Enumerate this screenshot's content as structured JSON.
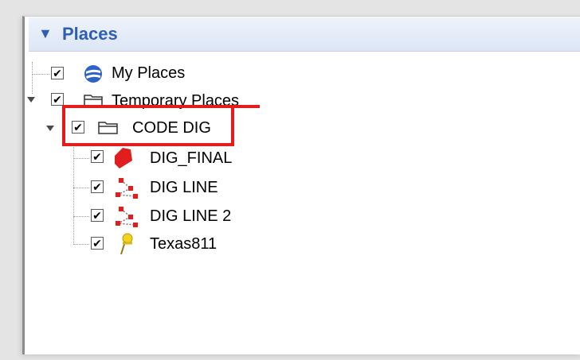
{
  "header": {
    "title": "Places",
    "icon": "triangle-down-icon"
  },
  "tree": {
    "my_places": {
      "label": "My Places",
      "checked": "✔",
      "icon": "earth-icon"
    },
    "temporary_places": {
      "label": "Temporary Places",
      "checked": "✔",
      "icon": "folder-icon"
    },
    "code_dig": {
      "label": "CODE DIG",
      "checked": "✔",
      "icon": "folder-icon"
    },
    "children": [
      {
        "label": "DIG_FINAL",
        "checked": "✔",
        "icon": "polygon-icon"
      },
      {
        "label": "DIG LINE",
        "checked": "✔",
        "icon": "path-icon"
      },
      {
        "label": "DIG LINE 2",
        "checked": "✔",
        "icon": "path-icon"
      },
      {
        "label": "Texas811",
        "checked": "✔",
        "icon": "pushpin-icon"
      }
    ]
  },
  "colors": {
    "accent": "#2f5fb3",
    "highlight": "#e41c1c",
    "polygon": "#e01e1e",
    "pin": "#f2d21b"
  }
}
